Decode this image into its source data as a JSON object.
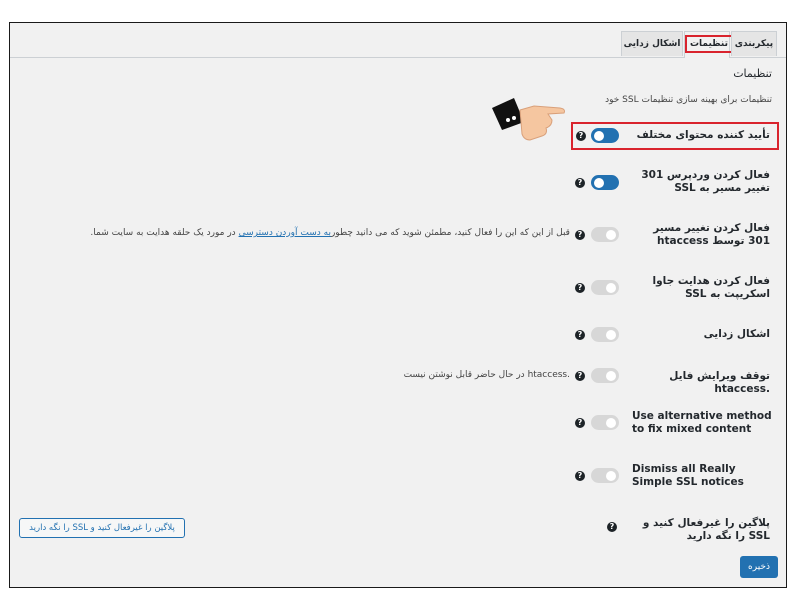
{
  "tabs": [
    {
      "label": "پیکربندی"
    },
    {
      "label": "تنظیمات",
      "active": true
    },
    {
      "label": "اشکال زدایی"
    }
  ],
  "section": {
    "title": "تنظیمات",
    "description": "تنظیمات برای بهینه سازی تنظیمات SSL خود"
  },
  "settings": [
    {
      "label": "تأیید کننده محتوای مختلف",
      "state": "on",
      "highlighted": true
    },
    {
      "label": "فعال کردن وردپرس 301 تغییر مسیر به SSL",
      "state": "on"
    },
    {
      "label": "فعال کردن تغییر مسیر 301 توسط htaccess",
      "state": "off",
      "note_before": "قبل از این که این را فعال کنید، مطمئن شوید که می دانید چطور",
      "note_link": "به دست آوردن دسترسی",
      "note_after": " در مورد یک حلقه هدایت به سایت شما."
    },
    {
      "label": "فعال کردن هدایت جاوا اسکریپت به SSL",
      "state": "off"
    },
    {
      "label": "اشکال زدایی",
      "state": "off"
    },
    {
      "label": "توقف ویرایش فایل .htaccess",
      "state": "off",
      "note": ".htaccess در حال حاضر قابل نوشتن نیست"
    },
    {
      "label": "Use alternative method to fix mixed content",
      "state": "off"
    },
    {
      "label": "Dismiss all Really Simple SSL notices",
      "state": "off"
    }
  ],
  "deactivate": {
    "label": "پلاگین را غیرفعال کنید و SSL را نگه دارید",
    "button_label": "پلاگین را غیرفعال کنید و SSL را نگه دارید"
  },
  "help_symbol": "?",
  "save_label": "ذخیره",
  "colors": {
    "accent": "#2271b1",
    "highlight": "#d9232d",
    "toggle_off": "#d7d7d7"
  }
}
